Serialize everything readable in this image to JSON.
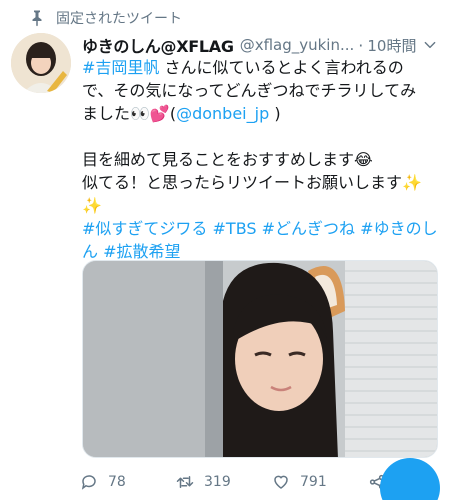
{
  "pinned_label": "固定されたツイート",
  "tweet": {
    "name": "ゆきのしん@XFLAG",
    "handle": "@xflag_yukin...",
    "separator": "·",
    "time": "10時間",
    "line1_hashtag": "#吉岡里帆",
    "line1_rest": " さんに似ているとよく言われるの",
    "line2": "で、その気になってどんぎつねでチラリしてみ",
    "line3_text": "ました👀💕(",
    "line3_mention": "@donbei_jp",
    "line3_end": " )",
    "line4": "目を細めて見ることをおすすめします😂",
    "line5": "似てる！と思ったらリツイートお願いします✨",
    "line6": "✨",
    "hashtags_line1": [
      "#似すぎてジワる",
      "#TBS",
      "#どんぎつね",
      "#ゆきのし"
    ],
    "hashtags_line2": [
      "ん",
      "#拡散希望"
    ]
  },
  "actions": {
    "replies": "78",
    "retweets": "319",
    "likes": "791"
  },
  "colors": {
    "accent": "#1da1f2",
    "muted": "#657786",
    "text": "#14171a"
  },
  "icons": [
    "pin-icon",
    "chevron-down-icon",
    "reply-icon",
    "retweet-icon",
    "heart-icon",
    "share-icon"
  ]
}
